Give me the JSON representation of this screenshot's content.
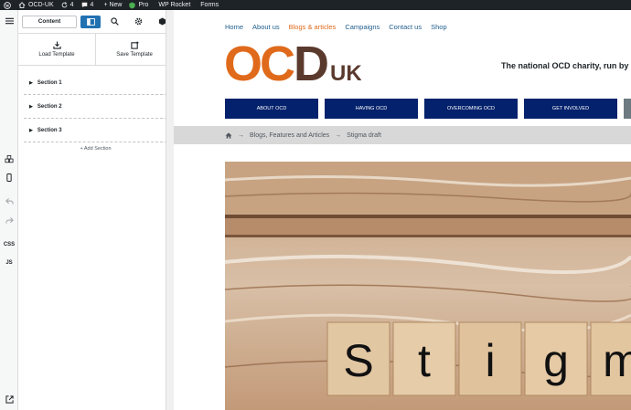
{
  "adminbar": {
    "site_name": "OCD-UK",
    "updates_count": "4",
    "comments_count": "4",
    "new_label": "+ New",
    "pro_label": "Pro",
    "wp_rocket_label": "WP Rocket",
    "forms_label": "Forms"
  },
  "rail": {
    "css_label": "CSS",
    "js_label": "JS"
  },
  "panel": {
    "content_tab": "Content",
    "load_template": "Load Template",
    "save_template": "Save Template",
    "sections": [
      {
        "label": "Section 1"
      },
      {
        "label": "Section 2"
      },
      {
        "label": "Section 3"
      }
    ],
    "add_section": "+ Add Section"
  },
  "site": {
    "topnav": [
      "Home",
      "About us",
      "Blogs & articles",
      "Campaigns",
      "Contact us",
      "Shop"
    ],
    "logo_letters": "OC",
    "logo_d": "D",
    "logo_uk": "UK",
    "tagline": "The national OCD charity, run by",
    "mainnav": [
      "About OCD",
      "Having OCD",
      "Overcoming OCD",
      "Get Involved"
    ],
    "breadcrumb": [
      "Blogs, Features and Articles",
      "Stigma draft"
    ],
    "breadcrumb_sep": "→",
    "hero_tiles": [
      "S",
      "t",
      "i",
      "g",
      "m"
    ]
  },
  "colors": {
    "admin_bg": "#1d2327",
    "accent_blue": "#2271b1",
    "nav_navy": "#03216c",
    "logo_orange": "#e06a1b",
    "logo_brown": "#5b3a2e",
    "link_blue": "#1f5d8c"
  }
}
